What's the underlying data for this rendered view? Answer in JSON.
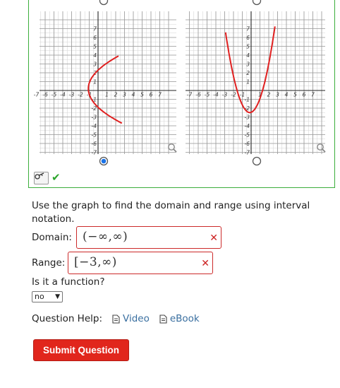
{
  "graphs": [
    {
      "x_ticks": [
        "-7",
        "-6",
        "-5",
        "-4",
        "-3",
        "-2",
        "-1",
        "1",
        "2",
        "3",
        "4",
        "5",
        "6",
        "7"
      ],
      "y_ticks_pos": [
        "7",
        "6",
        "5",
        "4",
        "3",
        "2",
        "1"
      ],
      "y_ticks_neg": [
        "-1",
        "-2",
        "-3",
        "-4",
        "-5",
        "-6",
        "-7"
      ],
      "selected": true
    },
    {
      "x_ticks": [
        "-7",
        "-6",
        "-5",
        "-4",
        "-3",
        "-2",
        "-1",
        "1",
        "2",
        "3",
        "4",
        "5",
        "6",
        "7"
      ],
      "y_ticks_pos": [
        "7",
        "6",
        "5",
        "4",
        "3",
        "2",
        "1"
      ],
      "y_ticks_neg": [
        "-1",
        "-2",
        "-3",
        "-4",
        "-5",
        "-6",
        "-7"
      ],
      "selected": false
    }
  ],
  "colors": {
    "curve": "#e02020",
    "correct": "#2ba52b",
    "incorrect": "#cc2222",
    "link": "#3a6fa0",
    "button": "#e1261c"
  },
  "question": {
    "instruction": "Use the graph to find the domain and range using interval notation.",
    "domain_label": "Domain:",
    "domain_value": "(−∞,∞)",
    "range_label": "Range:",
    "range_value": "[−3,∞)",
    "wrong_mark": "✕",
    "function_label": "Is it a function?",
    "function_value": "no"
  },
  "help": {
    "label": "Question Help:",
    "video": "Video",
    "ebook": "eBook"
  },
  "submit_label": "Submit Question",
  "icons": {
    "key": "key-icon",
    "check": "check-icon",
    "magnifier": "magnifier-icon",
    "doc": "document-icon"
  }
}
